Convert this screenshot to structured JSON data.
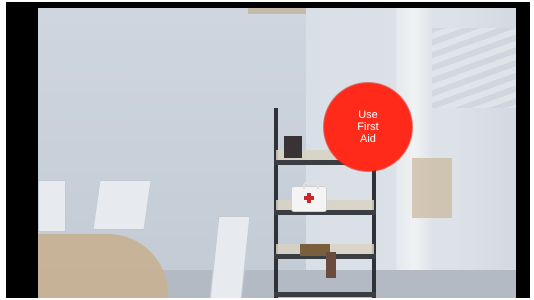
{
  "prompt": {
    "line1": "Use",
    "line2": "First",
    "line3": "Aid",
    "color": "#ff2a1a"
  },
  "scene": {
    "object_icon": "first-aid-kit-icon"
  }
}
